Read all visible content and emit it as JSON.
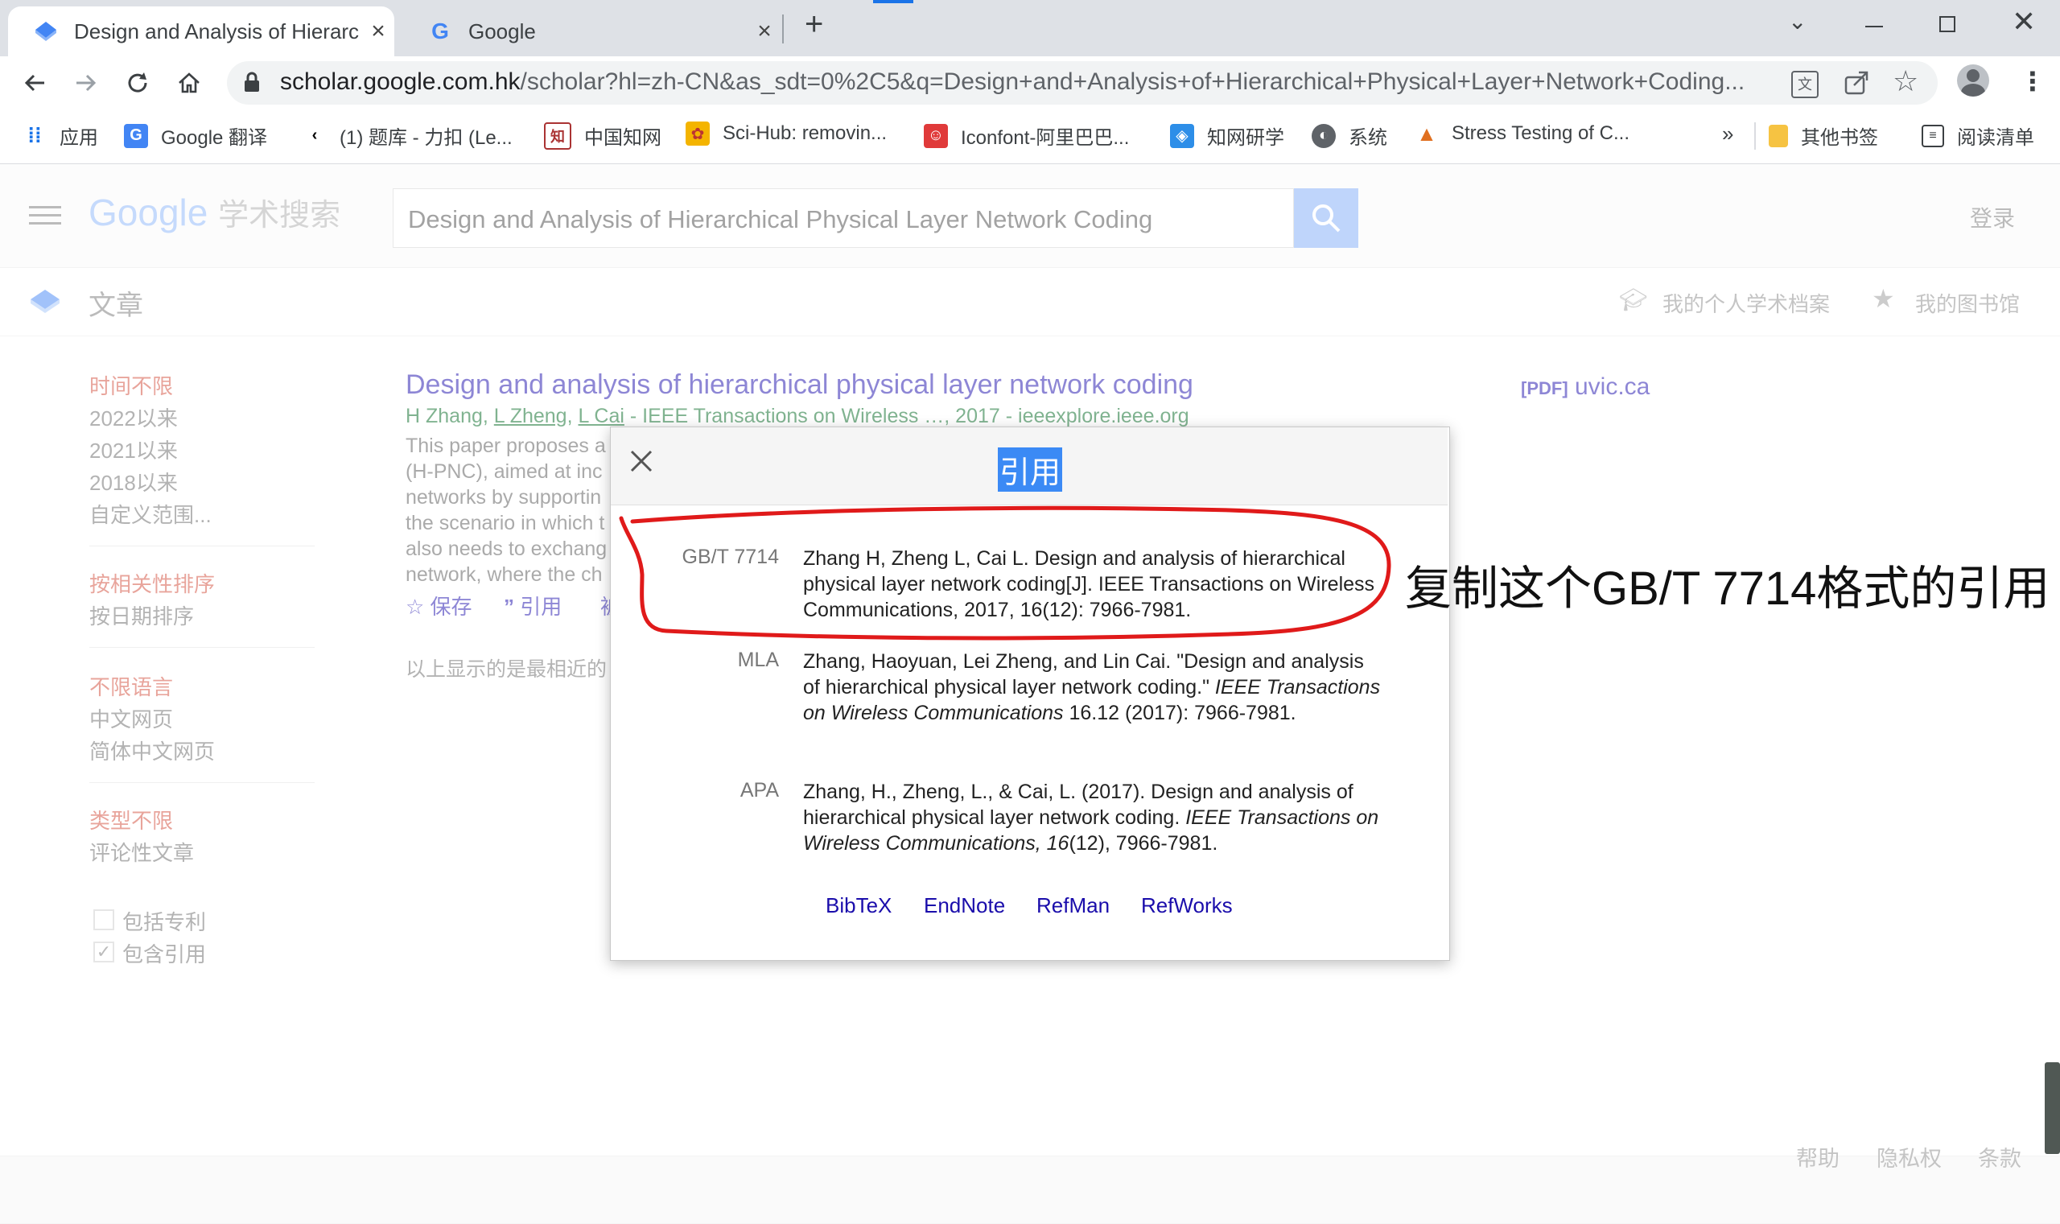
{
  "browser": {
    "tabs": [
      {
        "title": "Design and Analysis of Hierarc",
        "active": true
      },
      {
        "title": "Google",
        "active": false
      }
    ],
    "new_tab": "+",
    "url_host": "scholar.google.com.hk",
    "url_path": "/scholar?hl=zh-CN&as_sdt=0%2C5&q=Design+and+Analysis+of+Hierarchical+Physical+Layer+Network+Coding...",
    "bookmarks": [
      {
        "label": "应用"
      },
      {
        "label": "Google 翻译"
      },
      {
        "label": "(1) 题库 - 力扣 (Le..."
      },
      {
        "label": "中国知网"
      },
      {
        "label": "Sci-Hub: removin..."
      },
      {
        "label": "Iconfont-阿里巴巴..."
      },
      {
        "label": "知网研学"
      },
      {
        "label": "系统"
      },
      {
        "label": "Stress Testing of C..."
      }
    ],
    "bookmarks_overflow": "»",
    "other_bookmarks": "其他书签",
    "reading_list": "阅读清单"
  },
  "scholar": {
    "logo_google": "Google",
    "logo_suffix": "学术搜索",
    "query": "Design and Analysis of Hierarchical Physical Layer Network Coding",
    "signin": "登录",
    "section": "文章",
    "my_profile": "我的个人学术档案",
    "my_library": "我的图书馆",
    "sidebar": {
      "time_any": "时间不限",
      "since_2022": "2022以来",
      "since_2021": "2021以来",
      "since_2018": "2018以来",
      "custom_range": "自定义范围...",
      "sort_relevance": "按相关性排序",
      "sort_date": "按日期排序",
      "lang_any": "不限语言",
      "lang_chinese": "中文网页",
      "lang_simplified": "简体中文网页",
      "type_any": "类型不限",
      "type_review": "评论性文章",
      "include_patents": "包括专利",
      "include_citations": "包含引用"
    },
    "result": {
      "title": "Design and analysis of hierarchical physical layer network coding",
      "authors_prefix": "H Zhang, ",
      "author_link1": "L Zheng",
      "author_sep": ", ",
      "author_link2": "L Cai",
      "authors_suffix": " - IEEE Transactions on Wireless …, 2017 - ieeexplore.ieee.org",
      "snippet": [
        "This paper proposes a",
        "(H-PNC), aimed at inc",
        "networks by supportin",
        "the scenario in which t",
        "also needs to exchang",
        "network, where the ch"
      ],
      "save": "保存",
      "cite": "引用",
      "more_char": "被",
      "pdf_tag": "[PDF]",
      "pdf_domain": "uvic.ca"
    },
    "notice": "以上显示的是最相近的",
    "footer": {
      "help": "帮助",
      "privacy": "隐私权",
      "terms": "条款"
    }
  },
  "cite_dialog": {
    "title": "引用",
    "citations": [
      {
        "style": "GB/T 7714",
        "text": "Zhang H, Zheng L, Cai L. Design and analysis of hierarchical physical layer network coding[J]. IEEE Transactions on Wireless Communications, 2017, 16(12): 7966-7981."
      },
      {
        "style": "MLA",
        "pre": "Zhang, Haoyuan, Lei Zheng, and Lin Cai. \"Design and analysis of hierarchical physical layer network coding.\" ",
        "ital": "IEEE Transactions on Wireless Communications",
        "post": " 16.12 (2017): 7966-7981."
      },
      {
        "style": "APA",
        "pre": "Zhang, H., Zheng, L., & Cai, L. (2017). Design and analysis of hierarchical physical layer network coding. ",
        "ital": "IEEE Transactions on Wireless Communications, 16",
        "post": "(12), 7966-7981."
      }
    ],
    "exports": [
      "BibTeX",
      "EndNote",
      "RefMan",
      "RefWorks"
    ]
  },
  "annotation": "复制这个GB/T 7714格式的引用",
  "colors": {
    "link": "#1a0dab",
    "green": "#006621",
    "accent_red": "#d14836",
    "annot_red": "#e01a1a",
    "search_blue": "#7faaf6"
  }
}
